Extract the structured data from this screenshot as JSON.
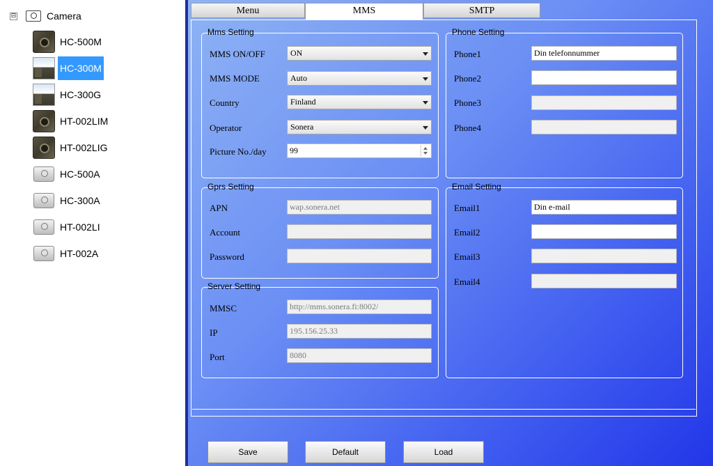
{
  "tree": {
    "root_label": "Camera",
    "expander": "⊟",
    "items": [
      {
        "label": "HC-500M",
        "icon": "camera-dark-icon"
      },
      {
        "label": "HC-300M",
        "icon": "camera-photo-icon",
        "selected": true
      },
      {
        "label": "HC-300G",
        "icon": "camera-photo-icon"
      },
      {
        "label": "HT-002LIM",
        "icon": "camera-dark-icon"
      },
      {
        "label": "HT-002LIG",
        "icon": "camera-dark-icon"
      },
      {
        "label": "HC-500A",
        "icon": "camera-grey-icon"
      },
      {
        "label": "HC-300A",
        "icon": "camera-grey-icon"
      },
      {
        "label": "HT-002LI",
        "icon": "camera-grey-icon"
      },
      {
        "label": "HT-002A",
        "icon": "camera-grey-icon"
      }
    ]
  },
  "tabs": [
    {
      "label": "Menu"
    },
    {
      "label": "MMS",
      "active": true
    },
    {
      "label": "SMTP"
    }
  ],
  "mms_setting": {
    "title": "Mms Setting",
    "onoff_label": "MMS ON/OFF",
    "onoff_value": "ON",
    "mode_label": "MMS MODE",
    "mode_value": "Auto",
    "country_label": "Country",
    "country_value": "Finland",
    "operator_label": "Operator",
    "operator_value": "Sonera",
    "picture_label": "Picture No./day",
    "picture_value": "99"
  },
  "phone_setting": {
    "title": "Phone Setting",
    "phone1_label": "Phone1",
    "phone1_value": "Din telefonnummer",
    "phone2_label": "Phone2",
    "phone2_value": "",
    "phone3_label": "Phone3",
    "phone3_value": "",
    "phone4_label": "Phone4",
    "phone4_value": ""
  },
  "gprs_setting": {
    "title": "Gprs Setting",
    "apn_label": "APN",
    "apn_value": "wap.sonera.net",
    "account_label": "Account",
    "account_value": "",
    "password_label": "Password",
    "password_value": ""
  },
  "email_setting": {
    "title": "Email Setting",
    "email1_label": "Email1",
    "email1_value": "Din e-mail",
    "email2_label": "Email2",
    "email2_value": "",
    "email3_label": "Email3",
    "email3_value": "",
    "email4_label": "Email4",
    "email4_value": ""
  },
  "server_setting": {
    "title": "Server Setting",
    "mmsc_label": "MMSC",
    "mmsc_value": "http://mms.sonera.fi:8002/",
    "ip_label": "IP",
    "ip_value": "195.156.25.33",
    "port_label": "Port",
    "port_value": "8080"
  },
  "buttons": {
    "save": "Save",
    "default": "Default",
    "load": "Load"
  },
  "colors": {
    "selection": "#3399ff",
    "panel_gradient_start": "#8fb3f4",
    "panel_gradient_end": "#2236e8"
  }
}
